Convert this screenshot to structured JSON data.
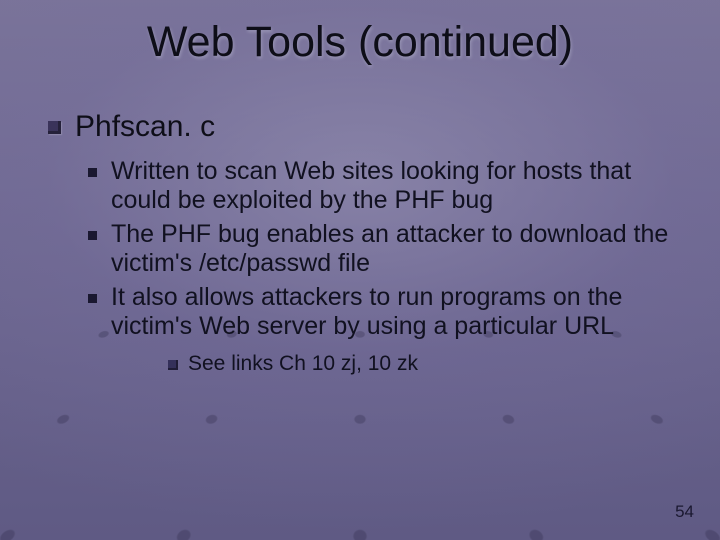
{
  "title": "Web Tools (continued)",
  "section": "Phfscan. c",
  "bullets": [
    "Written to scan Web sites looking for hosts that could be exploited by the PHF bug",
    "The PHF bug enables an attacker to download the victim's /etc/passwd file",
    "It also allows attackers to run programs on the victim's Web server by using a particular URL"
  ],
  "sub_note": "See links Ch 10 zj, 10 zk",
  "page_number": "54"
}
